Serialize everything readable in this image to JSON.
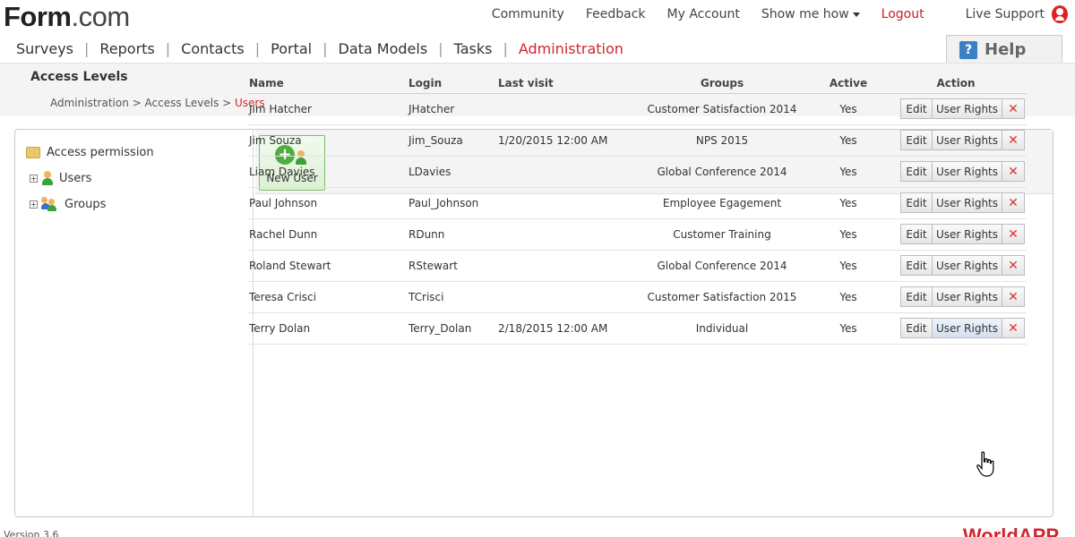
{
  "app": {
    "logo_main": "Form",
    "logo_domain": ".com",
    "footer_logo": "WorldAPP",
    "version_text": "Version 3.6"
  },
  "topnav": {
    "community": "Community",
    "feedback": "Feedback",
    "my_account": "My Account",
    "show_me_how": "Show me how",
    "logout": "Logout",
    "live_support": "Live Support"
  },
  "mainnav": {
    "items": [
      {
        "label": "Surveys"
      },
      {
        "label": "Reports"
      },
      {
        "label": "Contacts"
      },
      {
        "label": "Portal"
      },
      {
        "label": "Data Models"
      },
      {
        "label": "Tasks"
      },
      {
        "label": "Administration",
        "active": true
      }
    ]
  },
  "help": {
    "label": "Help",
    "icon": "?"
  },
  "page": {
    "title": "Access Levels",
    "breadcrumb": [
      {
        "label": "Administration"
      },
      {
        "label": "Access Levels"
      },
      {
        "label": "Users",
        "current": true
      }
    ]
  },
  "tree": {
    "root": "Access permission",
    "nodes": [
      {
        "label": "Users",
        "expander": "+"
      },
      {
        "label": "Groups",
        "expander": "+"
      }
    ]
  },
  "toolbar": {
    "new_user": "New User"
  },
  "table": {
    "headers": {
      "name": "Name",
      "login": "Login",
      "last_visit": "Last visit",
      "groups": "Groups",
      "active": "Active",
      "action": "Action"
    },
    "action_labels": {
      "edit": "Edit",
      "rights": "User Rights",
      "delete": "✕"
    },
    "rows": [
      {
        "name": "Jim Hatcher",
        "login": "JHatcher",
        "last_visit": "",
        "groups": "Customer Satisfaction 2014",
        "active": "Yes"
      },
      {
        "name": "Jim Souza",
        "login": "Jim_Souza",
        "last_visit": "1/20/2015 12:00 AM",
        "groups": "NPS 2015",
        "active": "Yes"
      },
      {
        "name": "Liam Davies",
        "login": "LDavies",
        "last_visit": "",
        "groups": "Global Conference 2014",
        "active": "Yes"
      },
      {
        "name": "Paul Johnson",
        "login": "Paul_Johnson",
        "last_visit": "",
        "groups": "Employee Egagement",
        "active": "Yes"
      },
      {
        "name": "Rachel Dunn",
        "login": "RDunn",
        "last_visit": "",
        "groups": "Customer Training",
        "active": "Yes"
      },
      {
        "name": "Roland Stewart",
        "login": "RStewart",
        "last_visit": "",
        "groups": "Global Conference 2014",
        "active": "Yes"
      },
      {
        "name": "Teresa Crisci",
        "login": "TCrisci",
        "last_visit": "",
        "groups": "Customer Satisfaction 2015",
        "active": "Yes"
      },
      {
        "name": "Terry Dolan",
        "login": "Terry_Dolan",
        "last_visit": "2/18/2015 12:00 AM",
        "groups": "Individual",
        "active": "Yes"
      }
    ]
  }
}
